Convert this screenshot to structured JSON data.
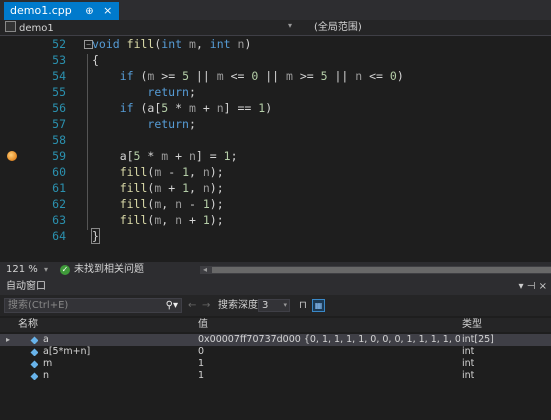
{
  "tab": {
    "label": "demo1.cpp",
    "pin": "⊕",
    "close": "×"
  },
  "navbar": {
    "scope": "demo1",
    "dropdown": "▾",
    "global": "(全局范围)"
  },
  "editor": {
    "lines": [
      {
        "no": "52",
        "html": "<span class=\"kw\">void</span> <span class=\"fn\">fill</span>(<span class=\"kw\">int</span> <span class=\"pm\">m</span>, <span class=\"kw\">int</span> <span class=\"pm\">n</span>)",
        "fold": "⊟"
      },
      {
        "no": "53",
        "html": "{"
      },
      {
        "no": "54",
        "html": "    <span class=\"kw\">if</span> (<span class=\"pm\">m</span> >= <span class=\"num\">5</span> || <span class=\"pm\">m</span> <= <span class=\"num\">0</span> || <span class=\"pm\">m</span> >= <span class=\"num\">5</span> || <span class=\"pm\">n</span> <= <span class=\"num\">0</span>)"
      },
      {
        "no": "55",
        "html": "        <span class=\"kw\">return</span>;"
      },
      {
        "no": "56",
        "html": "    <span class=\"kw\">if</span> (a[<span class=\"num\">5</span> * <span class=\"pm\">m</span> + <span class=\"pm\">n</span>] == <span class=\"num\">1</span>)"
      },
      {
        "no": "57",
        "html": "        <span class=\"kw\">return</span>;"
      },
      {
        "no": "58",
        "html": ""
      },
      {
        "no": "59",
        "html": "    a[<span class=\"num\">5</span> * <span class=\"pm\">m</span> + <span class=\"pm\">n</span>] = <span class=\"num\">1</span>;",
        "breakpoint": true
      },
      {
        "no": "60",
        "html": "    <span class=\"fn\">fill</span>(<span class=\"pm\">m</span> - <span class=\"num\">1</span>, <span class=\"pm\">n</span>);"
      },
      {
        "no": "61",
        "html": "    <span class=\"fn\">fill</span>(<span class=\"pm\">m</span> + <span class=\"num\">1</span>, <span class=\"pm\">n</span>);"
      },
      {
        "no": "62",
        "html": "    <span class=\"fn\">fill</span>(<span class=\"pm\">m</span>, <span class=\"pm\">n</span> - <span class=\"num\">1</span>);"
      },
      {
        "no": "63",
        "html": "    <span class=\"fn\">fill</span>(<span class=\"pm\">m</span>, <span class=\"pm\">n</span> + <span class=\"num\">1</span>);"
      },
      {
        "no": "64",
        "html": "<span class=\"cur\">}</span>"
      }
    ]
  },
  "statusbar": {
    "zoom": "121 %",
    "zoom_dd": "▾",
    "issues_icon": "✓",
    "issues": "未找到相关问题"
  },
  "autos": {
    "title": "自动窗口",
    "controls": "▾ ⊣ ×"
  },
  "toolbar": {
    "search_placeholder": "搜索(Ctrl+E)",
    "search_icon": "⚲▾",
    "back": "←",
    "forward": "→",
    "depth_label": "搜索深度:",
    "depth_value": "3",
    "depth_dd": "▾",
    "pin": "⊓",
    "hex": "🗗"
  },
  "grid": {
    "headers": {
      "name": "名称",
      "value": "值",
      "type": "类型"
    },
    "rows": [
      {
        "expand": "▸",
        "name": "a",
        "value": "0x00007ff70737d000 {0, 1, 1, 1, 1, 0, 0, 0, 1, 1, 1, 1, 0, 1, 0, 0, 1, 0, 1, 0, ...",
        "type": "int[25]",
        "selected": true,
        "icon_color": "#68b3ea"
      },
      {
        "expand": "",
        "name": "a[5*m+n]",
        "value": "0",
        "type": "int",
        "selected": false,
        "icon_color": "#68b3ea"
      },
      {
        "expand": "",
        "name": "m",
        "value": "1",
        "type": "int",
        "selected": false,
        "icon_color": "#68b3ea"
      },
      {
        "expand": "",
        "name": "n",
        "value": "1",
        "type": "int",
        "selected": false,
        "icon_color": "#68b3ea"
      }
    ]
  }
}
